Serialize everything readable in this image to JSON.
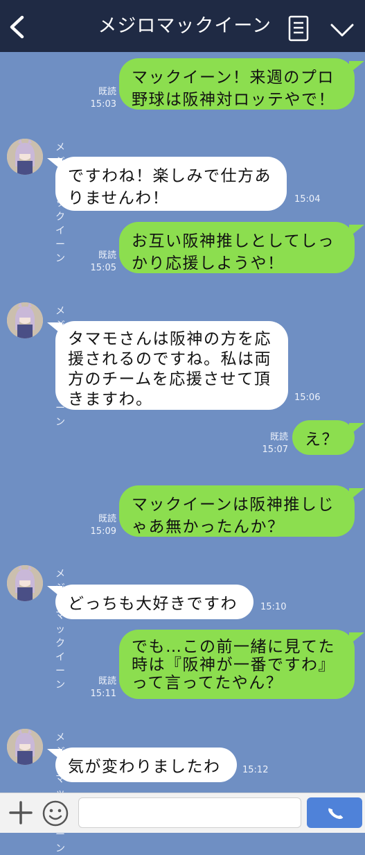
{
  "header": {
    "title": "メジロマックイーン"
  },
  "chat": {
    "contact_name": "メジロマックイーン",
    "messages": [
      {
        "from": "me",
        "lines": [
          "マックイーン！来週のプロ",
          "野球は阪神対ロッテやで！"
        ],
        "read": "既読",
        "time": "15:03"
      },
      {
        "from": "them",
        "lines": [
          "ですわね！楽しみで仕方あ",
          "りませんわ！"
        ],
        "time": "15:04"
      },
      {
        "from": "me",
        "lines": [
          "お互い阪神推しとしてしっ",
          "かり応援しようや！"
        ],
        "read": "既読",
        "time": "15:05"
      },
      {
        "from": "them",
        "lines": [
          "タマモさんは阪神の方を応",
          "援されるのですね。私は両",
          "方のチームを応援させて頂",
          "きますわ。"
        ],
        "time": "15:06"
      },
      {
        "from": "me",
        "lines": [
          "え？"
        ],
        "read": "既読",
        "time": "15:07"
      },
      {
        "from": "me",
        "lines": [
          "マックイーンは阪神推しじ",
          "ゃあ無かったんか？"
        ],
        "read": "既読",
        "time": "15:09"
      },
      {
        "from": "them",
        "lines": [
          "どっちも大好きですわ"
        ],
        "time": "15:10"
      },
      {
        "from": "me",
        "lines": [
          "でも…この前一緒に見てた",
          "時は『阪神が一番ですわ』",
          "って言ってたやん？"
        ],
        "read": "既読",
        "time": "15:11"
      },
      {
        "from": "them",
        "lines": [
          "気が変わりましたわ"
        ],
        "time": "15:12"
      }
    ]
  },
  "input": {
    "value": "",
    "placeholder": ""
  },
  "icons": {
    "back": "chevron-left-icon",
    "memo": "notes-icon",
    "menu": "chevron-down-icon",
    "plus": "plus-icon",
    "emoji": "emoji-icon",
    "call": "phone-icon"
  },
  "colors": {
    "background": "#6f8fc3",
    "header": "#1f2a44",
    "my_bubble": "#8cde4f",
    "their_bubble": "#ffffff",
    "call_button": "#4f82d9"
  }
}
